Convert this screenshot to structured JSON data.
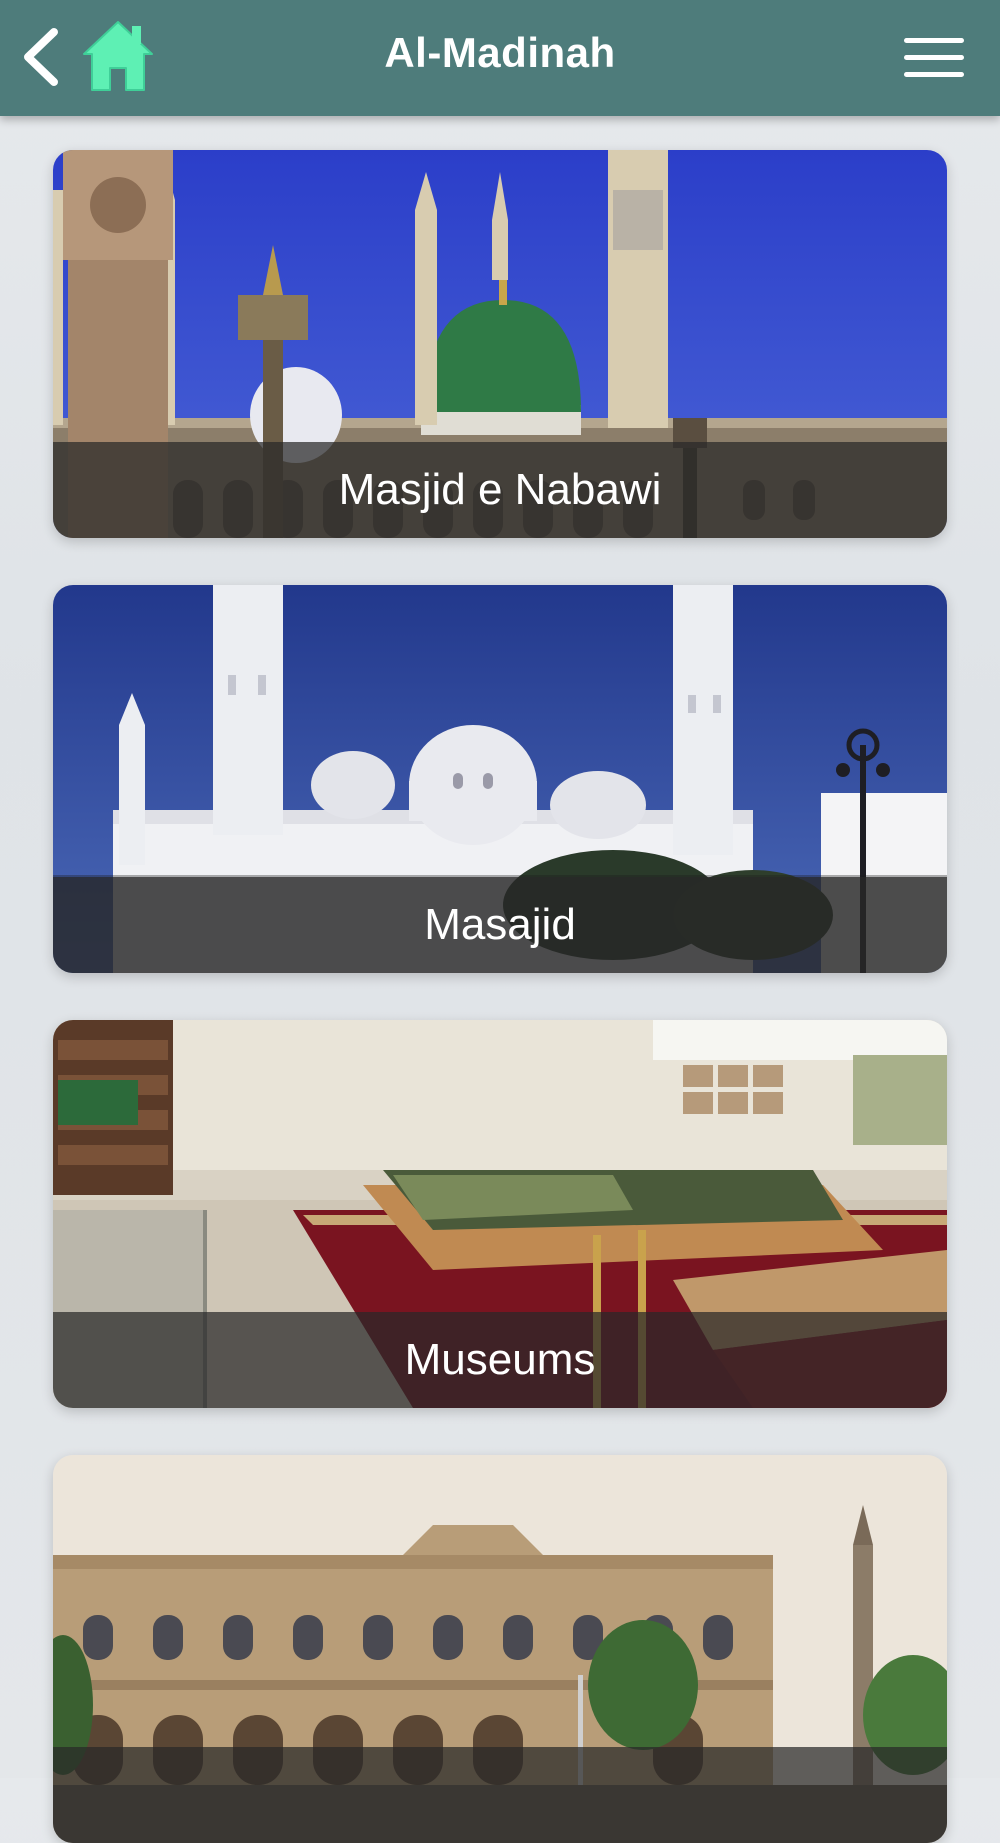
{
  "header": {
    "title": "Al-Madinah",
    "back_icon": "chevron-left-icon",
    "home_icon": "home-icon",
    "menu_icon": "hamburger-menu-icon",
    "bar_color": "#4e7c7b",
    "home_color": "#5ef0b4"
  },
  "categories": [
    {
      "label": "Masjid e Nabawi"
    },
    {
      "label": "Masajid"
    },
    {
      "label": "Museums"
    },
    {
      "label": ""
    }
  ]
}
